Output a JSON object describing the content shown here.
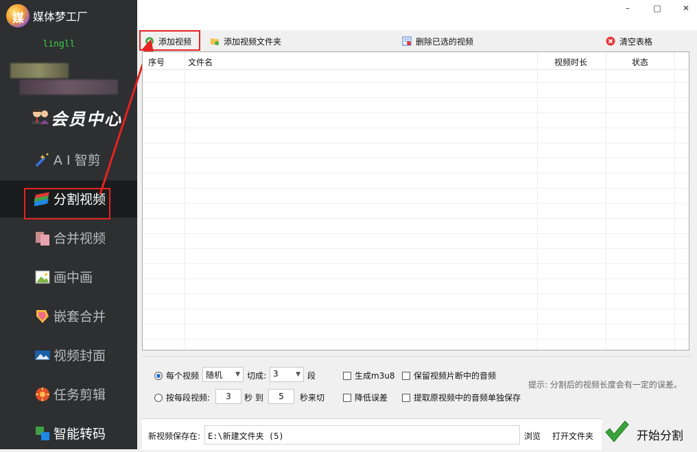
{
  "app": {
    "title": "媒体梦工厂",
    "logo_char": "媒"
  },
  "user": {
    "name": "lingll"
  },
  "vip": {
    "label": "会员中心"
  },
  "nav": [
    {
      "label": "A I 智剪",
      "icon": "magic-wand-icon"
    },
    {
      "label": "分割视频",
      "icon": "split-video-icon",
      "active": true
    },
    {
      "label": "合并视频",
      "icon": "merge-video-icon"
    },
    {
      "label": "画中画",
      "icon": "picture-in-picture-icon"
    },
    {
      "label": "嵌套合并",
      "icon": "nest-merge-icon"
    },
    {
      "label": "视频封面",
      "icon": "video-cover-icon"
    },
    {
      "label": "任务剪辑",
      "icon": "task-edit-icon"
    },
    {
      "label": "智能转码",
      "icon": "smart-transcode-icon"
    }
  ],
  "window": {
    "minimize": "–",
    "maximize": "□",
    "close": "✕"
  },
  "toolbar": {
    "add_video": "添加视频",
    "add_folder": "添加视频文件夹",
    "delete_selected": "删除已选的视频",
    "clear_table": "清空表格"
  },
  "table": {
    "columns": [
      "序号",
      "文件名",
      "视频时长",
      "状态"
    ],
    "rows": []
  },
  "options": {
    "per_video_label": "每个视频",
    "mode_value": "随机",
    "cut_into_label": "切成:",
    "cut_count": "3",
    "segment_unit": "段",
    "per_segment_label": "按每段视频:",
    "seg_from": "3",
    "sec_label": "秒 到",
    "seg_to": "5",
    "sec_cut_label": "秒来切",
    "gen_m3u8": "生成m3u8",
    "reduce_error": "降低误差",
    "keep_audio": "保留视频片断中的音频",
    "extract_audio": "提取原视频中的音频单独保存",
    "hint": "提示: 分割后的视频长度会有一定的误差。"
  },
  "save": {
    "label": "新视频保存在:",
    "path": "E:\\新建文件夹 (5)",
    "browse": "浏览",
    "open_folder": "打开文件夹",
    "start": "开始分割"
  },
  "colors": {
    "sidebar_bg": "#2d2f31",
    "accent_blue": "#1f6fd6",
    "highlight_red": "#e62222",
    "username_green": "#3cd34a"
  }
}
